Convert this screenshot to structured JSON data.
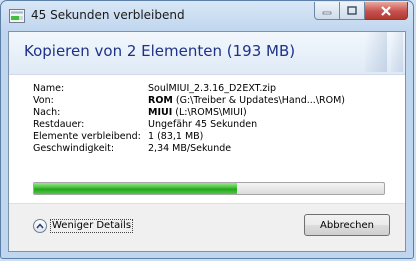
{
  "window": {
    "title": "45 Sekunden verbleibend",
    "icon": "copy-progress-icon",
    "controls": [
      "minimize-icon",
      "maximize-icon",
      "close-icon"
    ]
  },
  "header": {
    "title": "Kopieren von 2 Elementen (193 MB)"
  },
  "details": {
    "name_label": "Name:",
    "name_value": "SoulMIUI_2.3.16_D2EXT.zip",
    "from_label": "Von:",
    "from_bold": "ROM",
    "from_path": "(G:\\Treiber & Updates\\Hand...\\ROM)",
    "to_label": "Nach:",
    "to_bold": "MIUI",
    "to_path": "(L:\\ROMS\\MIUI)",
    "remaining_time_label": "Restdauer:",
    "remaining_time_value": "Ungefähr 45 Sekunden",
    "items_remaining_label": "Elemente verbleibend:",
    "items_remaining_value": "1 (83,1 MB)",
    "speed_label": "Geschwindigkeit:",
    "speed_value": "2,34 MB/Sekunde"
  },
  "progress": {
    "fraction": 0.58,
    "color": "#2fb52a"
  },
  "footer": {
    "details_toggle_label": "Weniger Details",
    "cancel_label": "Abbrechen"
  }
}
